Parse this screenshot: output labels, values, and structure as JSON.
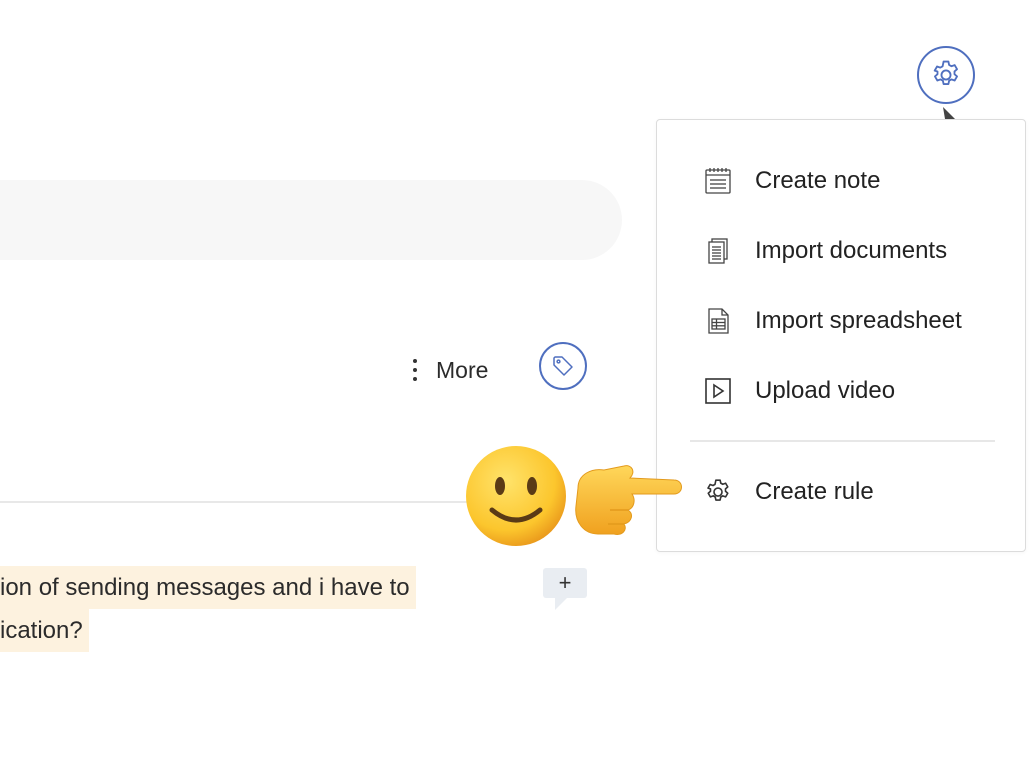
{
  "menu": {
    "items": [
      {
        "label": "Create note",
        "icon": "notepad-icon"
      },
      {
        "label": "Import documents",
        "icon": "documents-icon"
      },
      {
        "label": "Import spreadsheet",
        "icon": "spreadsheet-icon"
      },
      {
        "label": "Upload video",
        "icon": "video-play-icon"
      },
      {
        "label": "Create rule",
        "icon": "gear-icon"
      }
    ]
  },
  "toolbar": {
    "more_label": "More",
    "tag_icon": "tag-icon",
    "settings_icon": "gear-icon"
  },
  "content": {
    "lines": [
      "ion of sending messages and i have to",
      "ication?"
    ],
    "comment_add_label": "+"
  },
  "colors": {
    "accent": "#4f6fbf",
    "highlight": "#fdf2df",
    "search_bg": "#f7f7f7"
  }
}
